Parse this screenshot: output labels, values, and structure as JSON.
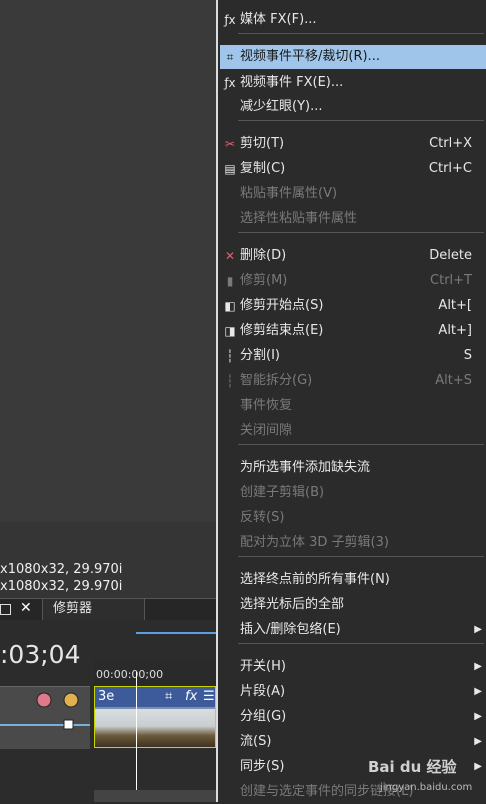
{
  "left": {
    "info_line1": "x1080x32, 29.970i",
    "info_line2": "x1080x32, 29.970i",
    "tab_close": "✕",
    "tab_trimmer": "修剪器",
    "timecode": ":03;04",
    "ruler_label": "00:00:00;00",
    "clip_title": "3e",
    "fx_label": "fx",
    "clip_menu": "☰"
  },
  "menu": {
    "items": [
      {
        "label": "媒体 FX(F)...",
        "shortcut": "",
        "icon": "fx",
        "disabled": false
      },
      {
        "label": "视频事件平移/裁切(R)...",
        "shortcut": "",
        "icon": "crop",
        "disabled": false,
        "highlight": true
      },
      {
        "label": "视频事件 FX(E)...",
        "shortcut": "",
        "icon": "fx",
        "disabled": false
      },
      {
        "label": "减少红眼(Y)...",
        "shortcut": "",
        "icon": "",
        "disabled": false
      },
      {
        "label": "剪切(T)",
        "shortcut": "Ctrl+X",
        "icon": "scissors",
        "disabled": false
      },
      {
        "label": "复制(C)",
        "shortcut": "Ctrl+C",
        "icon": "copy",
        "disabled": false
      },
      {
        "label": "粘贴事件属性(V)",
        "shortcut": "",
        "icon": "",
        "disabled": true
      },
      {
        "label": "选择性粘贴事件属性",
        "shortcut": "",
        "icon": "",
        "disabled": true
      },
      {
        "label": "删除(D)",
        "shortcut": "Delete",
        "icon": "delete",
        "disabled": false
      },
      {
        "label": "修剪(M)",
        "shortcut": "Ctrl+T",
        "icon": "trim",
        "disabled": true
      },
      {
        "label": "修剪开始点(S)",
        "shortcut": "Alt+[",
        "icon": "trim-start",
        "disabled": false
      },
      {
        "label": "修剪结束点(E)",
        "shortcut": "Alt+]",
        "icon": "trim-end",
        "disabled": false
      },
      {
        "label": "分割(I)",
        "shortcut": "S",
        "icon": "split",
        "disabled": false
      },
      {
        "label": "智能拆分(G)",
        "shortcut": "Alt+S",
        "icon": "smart-split",
        "disabled": true
      },
      {
        "label": "事件恢复",
        "shortcut": "",
        "icon": "",
        "disabled": true
      },
      {
        "label": "关闭间隙",
        "shortcut": "",
        "icon": "",
        "disabled": true
      },
      {
        "label": "为所选事件添加缺失流",
        "shortcut": "",
        "icon": "",
        "disabled": false
      },
      {
        "label": "创建子剪辑(B)",
        "shortcut": "",
        "icon": "",
        "disabled": true
      },
      {
        "label": "反转(S)",
        "shortcut": "",
        "icon": "",
        "disabled": true
      },
      {
        "label": "配对为立体 3D 子剪辑(3)",
        "shortcut": "",
        "icon": "",
        "disabled": true
      },
      {
        "label": "选择终点前的所有事件(N)",
        "shortcut": "",
        "icon": "",
        "disabled": false
      },
      {
        "label": "选择光标后的全部",
        "shortcut": "",
        "icon": "",
        "disabled": false
      },
      {
        "label": "插入/删除包络(E)",
        "shortcut": "",
        "icon": "",
        "disabled": false,
        "submenu": true
      },
      {
        "label": "开关(H)",
        "shortcut": "",
        "icon": "",
        "disabled": false,
        "submenu": true
      },
      {
        "label": "片段(A)",
        "shortcut": "",
        "icon": "",
        "disabled": false,
        "submenu": true
      },
      {
        "label": "分组(G)",
        "shortcut": "",
        "icon": "",
        "disabled": false,
        "submenu": true
      },
      {
        "label": "流(S)",
        "shortcut": "",
        "icon": "",
        "disabled": false,
        "submenu": true
      },
      {
        "label": "同步(S)",
        "shortcut": "",
        "icon": "",
        "disabled": false,
        "submenu": true
      },
      {
        "label": "创建与选定事件的同步链接(L)",
        "shortcut": "",
        "icon": "",
        "disabled": true
      }
    ]
  },
  "watermark": {
    "brand": "Bai du 经验",
    "url": "jingyan.baidu.com"
  }
}
